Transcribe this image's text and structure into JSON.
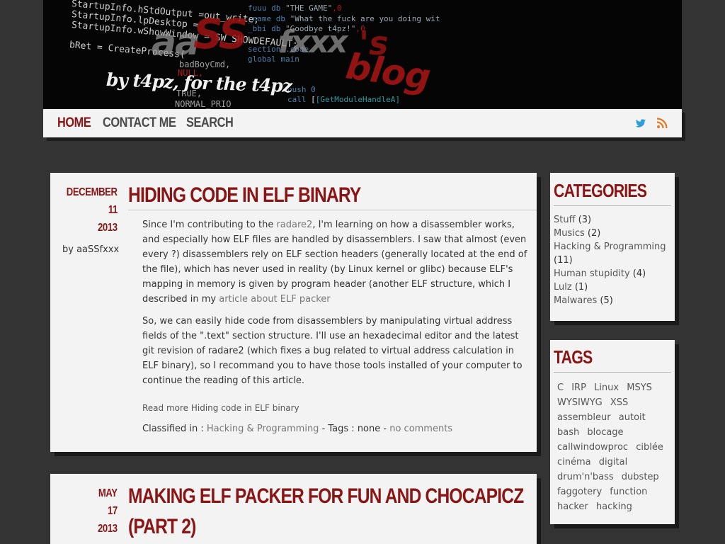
{
  "banner": {
    "code_left": [
      "StartupInfo.hStdOutput =out_write;",
      "StartupInfo.lpDesktop =",
      "StartupInfo.wShowWindow = SW_SHOWDEFAULT;",
      "bRet = CreateProcess("
    ],
    "code_mid": [
      "badBoyCmd,",
      "NULL,",
      "TRUE,",
      "NORMAL_PRIO"
    ],
    "code_right": [
      {
        "a": "fuuu db ",
        "b": "\"THE GAME\"",
        "c": ",0"
      },
      {
        "a": "_name db ",
        "b": "\"What the fuck are you doing wit",
        "c": ""
      },
      {
        "a": "_bbi db ",
        "b": "\"Goodbye t4pz!\"",
        "c": ",0"
      },
      {
        "a": "section .code",
        "b": "",
        "c": ""
      },
      {
        "a": "global main",
        "b": "",
        "c": ""
      },
      {
        "a": "push 0",
        "b": "",
        "c": ""
      },
      {
        "a": "call ",
        "b": "[GetModuleHandleA]",
        "c": ""
      }
    ],
    "logo": {
      "aa": "aa",
      "ss": "SS",
      "fxxx": "fxxx",
      "s": "'s",
      "blog": "blog"
    },
    "tagline": "by t4pz, for the t4pz"
  },
  "nav": {
    "home": "Home",
    "contact": "Contact me",
    "search": "Search",
    "twitter_icon": "twitter-bird-icon",
    "rss_icon": "rss-feed-icon"
  },
  "colors": {
    "accent": "#8a1515",
    "background": "#333333",
    "panel": "#f3f3f3",
    "twitter": "#2f9ed8",
    "rss": "#e8761e"
  },
  "posts": [
    {
      "date_month": "December",
      "date_day": "11",
      "date_year": "2013",
      "author": "by aaSSfxxx",
      "title": "Hiding code in ELF binary",
      "p1_a": "Since I'm contributing to the ",
      "p1_link": "radare2",
      "p1_b": ", I'm learning on how a disassembler works, and especially how ELF files are handled by disassemblers. I saw that almost (even every ?) disassemblers rely on ELF section headers (generally located at the end of the file), which has never used in reality (by Linux kernel or glibc) because ELF's mapping in memory is given by program header (another ELF structure, which I described in my ",
      "p1_link2": "article about ELF packer",
      "p2": "So, we can easily hide code from disassemblers by manipulating virtual address fields of the \".text\" section structure. I'll use an hexadecimal editor and the latest git revision of radare2 (which fixes a bug related to virtual address calculation in ELF binary), so I recommand you to have those tools installed of your computer to continue the reading of this article.",
      "read_more": "Read more Hiding code in ELF binary",
      "classified_prefix": "Classified in : ",
      "category": "Hacking & Programming",
      "tags_text": " - Tags : none - ",
      "comments": "no comments"
    },
    {
      "date_month": "May",
      "date_day": "17",
      "date_year": "2013",
      "title_line1": "Making ELF packer for fun and chocapicz",
      "title_line2": "(part 2)"
    }
  ],
  "sidebar": {
    "categories_title": "Categories",
    "categories": [
      {
        "name": "Stuff",
        "count": " (3)"
      },
      {
        "name": "Musics",
        "count": " (2)"
      },
      {
        "name": "Hacking & Programming",
        "count": " (11)"
      },
      {
        "name": "Human stupidity",
        "count": " (4)"
      },
      {
        "name": "Lulz",
        "count": " (1)"
      },
      {
        "name": "Malwares",
        "count": " (5)"
      }
    ],
    "tags_title": "Tags",
    "tags": [
      "C",
      "IRP",
      "Linux",
      "MSYS",
      "WYSIWYG",
      "XSS",
      "assembleur",
      "autoit",
      "bash",
      "blocage",
      "callwindowproc",
      "ciblée",
      "cinéma",
      "digital",
      "drum'n'bass",
      "dubstep",
      "faggotery",
      "function",
      "hacker",
      "hacking"
    ]
  }
}
